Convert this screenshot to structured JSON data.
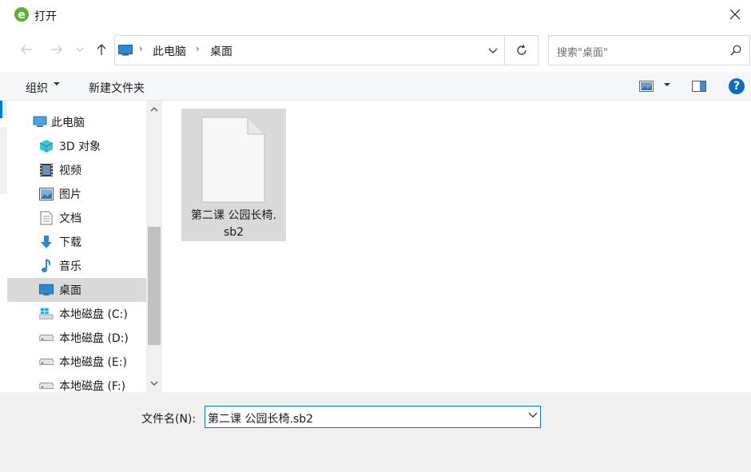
{
  "window": {
    "title": "打开",
    "close_glyph": "✕"
  },
  "nav": {
    "path": [
      "此电脑",
      "桌面"
    ],
    "search_placeholder": "搜索\"桌面\""
  },
  "toolbar": {
    "organize_label": "组织",
    "new_folder_label": "新建文件夹",
    "help_glyph": "?"
  },
  "tree": [
    {
      "label": "此电脑",
      "icon": "computer-icon",
      "indent": 0
    },
    {
      "label": "3D 对象",
      "icon": "3d-objects-icon",
      "indent": 1
    },
    {
      "label": "视频",
      "icon": "videos-icon",
      "indent": 1
    },
    {
      "label": "图片",
      "icon": "pictures-icon",
      "indent": 1
    },
    {
      "label": "文档",
      "icon": "documents-icon",
      "indent": 1
    },
    {
      "label": "下载",
      "icon": "downloads-icon",
      "indent": 1
    },
    {
      "label": "音乐",
      "icon": "music-icon",
      "indent": 1
    },
    {
      "label": "桌面",
      "icon": "desktop-icon",
      "indent": 1,
      "selected": true
    },
    {
      "label": "本地磁盘 (C:)",
      "icon": "windows-drive-icon",
      "indent": 1
    },
    {
      "label": "本地磁盘 (D:)",
      "icon": "drive-icon",
      "indent": 1
    },
    {
      "label": "本地磁盘 (E:)",
      "icon": "drive-icon",
      "indent": 1
    },
    {
      "label": "本地磁盘 (F:)",
      "icon": "drive-icon",
      "indent": 1
    }
  ],
  "files": [
    {
      "name_line1": "第二课 公园长椅.",
      "name_line2": "sb2",
      "icon": "generic-file-icon"
    }
  ],
  "footer": {
    "filename_label": "文件名(N):",
    "filename_value": "第二课 公园长椅.sb2"
  },
  "colors": {
    "accent": "#0078d7",
    "selection": "#d9d9d9",
    "toolbar_bg": "#f5f6f7",
    "footer_bg": "#f0f0f0"
  }
}
